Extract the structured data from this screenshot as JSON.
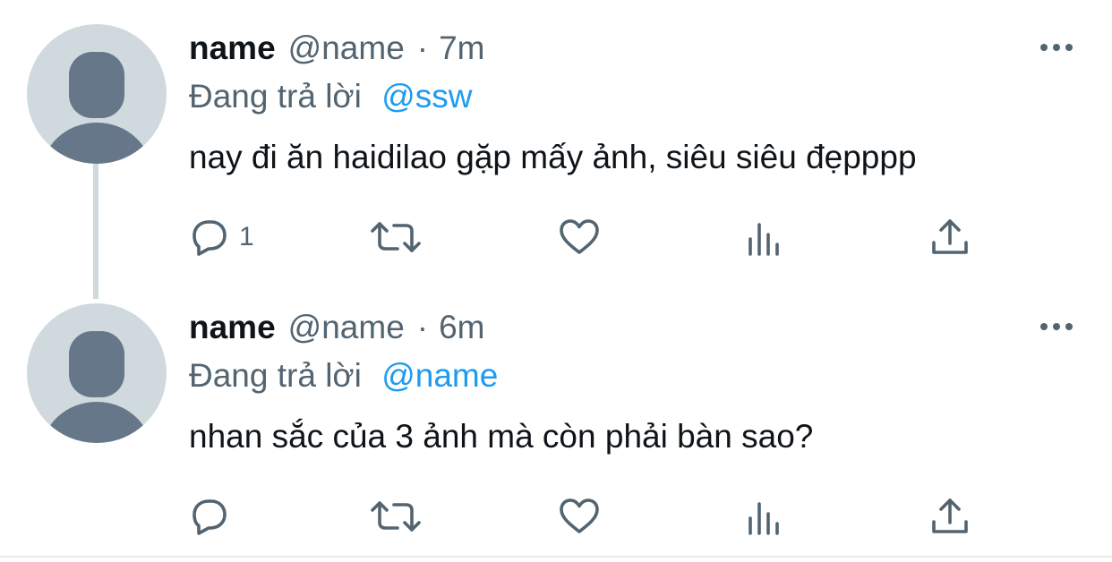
{
  "tweets": [
    {
      "display_name": "name",
      "handle": "@name",
      "separator": "·",
      "time": "7m",
      "replying_prefix": "Đang trả lời",
      "replying_to": "@ssw",
      "text": "nay đi ăn haidilao gặp mấy ảnh, siêu siêu đẹpppp",
      "reply_count": "1"
    },
    {
      "display_name": "name",
      "handle": "@name",
      "separator": "·",
      "time": "6m",
      "replying_prefix": "Đang trả lời",
      "replying_to": "@name",
      "text": "nhan sắc của 3 ảnh mà còn phải bàn sao?",
      "reply_count": ""
    }
  ],
  "icons": {
    "more": "more-horizontal-icon",
    "reply": "reply-bubble-icon",
    "retweet": "retweet-icon",
    "like": "heart-icon",
    "views": "views-chart-icon",
    "share": "share-upload-icon"
  },
  "colors": {
    "text": "#0f1419",
    "secondary": "#536471",
    "link": "#1d9bf0",
    "avatar_bg": "#cfd9de",
    "avatar_figure": "#66778a",
    "thread_line": "#cfd9de"
  }
}
